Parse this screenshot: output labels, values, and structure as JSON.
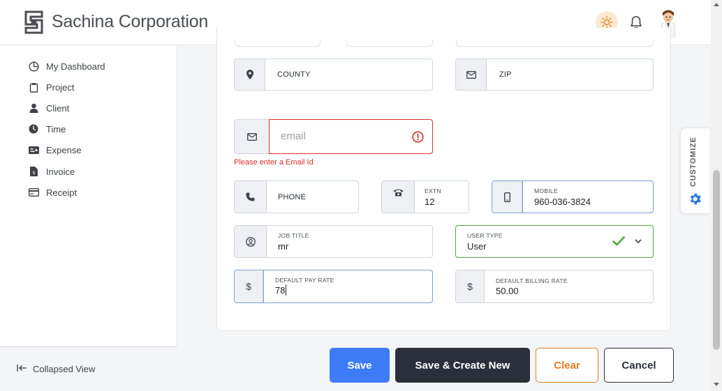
{
  "header": {
    "company": "Sachina Corporation",
    "logo_icon": "sachina-logo-icon",
    "theme_icon": "sun-icon",
    "notifications_icon": "bell-icon",
    "avatar_icon": "user-avatar-icon"
  },
  "sidebar": {
    "items": [
      {
        "label": "My Dashboard",
        "icon": "dashboard-icon"
      },
      {
        "label": "Project",
        "icon": "clipboard-icon"
      },
      {
        "label": "Client",
        "icon": "user-icon"
      },
      {
        "label": "Time",
        "icon": "clock-icon"
      },
      {
        "label": "Expense",
        "icon": "money-icon"
      },
      {
        "label": "Invoice",
        "icon": "invoice-icon"
      },
      {
        "label": "Receipt",
        "icon": "receipt-icon"
      }
    ],
    "collapse_label": "Collapsed View"
  },
  "form": {
    "county": {
      "placeholder": "COUNTY",
      "icon": "map-pin-icon"
    },
    "zip": {
      "placeholder": "ZIP",
      "icon": "envelope-icon"
    },
    "email": {
      "placeholder": "email",
      "value": "",
      "error": "Please enter a Email Id",
      "icon": "envelope-icon"
    },
    "phone": {
      "placeholder": "PHONE",
      "icon": "phone-icon"
    },
    "extn": {
      "label": "EXTN",
      "value": "12",
      "icon": "telephone-icon"
    },
    "mobile": {
      "label": "MOBILE",
      "value": "960-036-3824",
      "icon": "mobile-icon"
    },
    "job_title": {
      "label": "JOB TITLE",
      "value": "mr",
      "icon": "user-circle-icon"
    },
    "user_type": {
      "label": "USER TYPE",
      "value": "User"
    },
    "default_pay_rate": {
      "label": "DEFAULT PAY RATE",
      "value": "78",
      "symbol": "$"
    },
    "default_billing_rate": {
      "label": "DEFAULT BILLING RATE",
      "value": "50.00",
      "symbol": "$"
    }
  },
  "buttons": {
    "save": "Save",
    "save_create": "Save & Create New",
    "clear": "Clear",
    "cancel": "Cancel"
  },
  "customize": {
    "label": "CUSTOMIZE",
    "icon": "gear-icon"
  },
  "colors": {
    "primary": "#3d7bf7",
    "dark": "#2b2f3b",
    "warning": "#e07b20",
    "error": "#d93025",
    "success": "#4bab3a"
  }
}
